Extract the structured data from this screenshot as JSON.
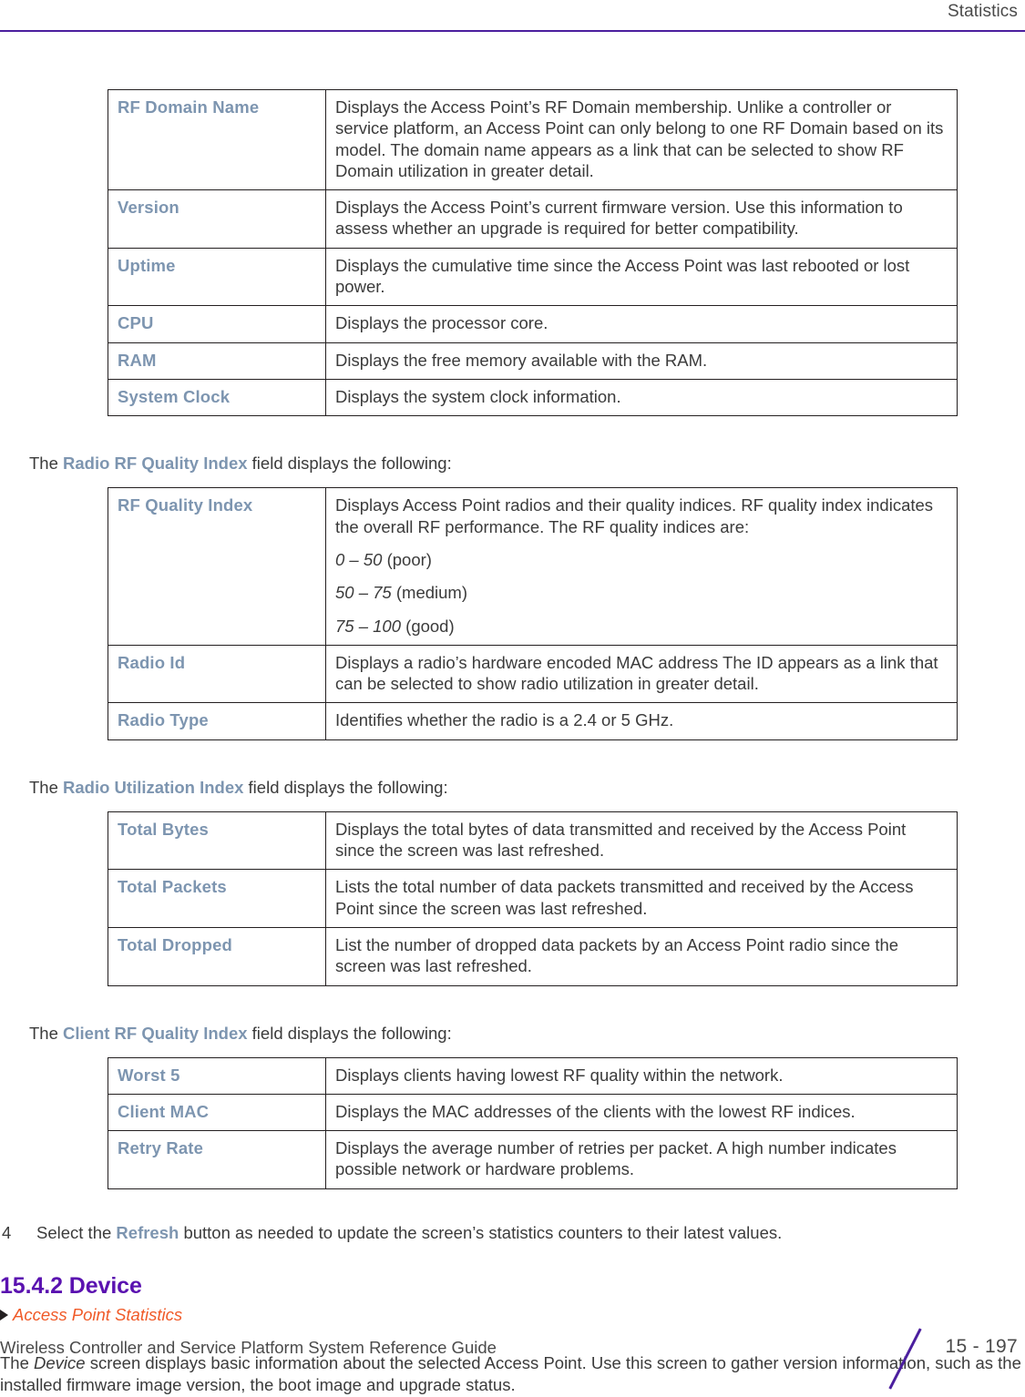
{
  "header": {
    "title": "Statistics",
    "rule_color": "#4b1f9e"
  },
  "tables": [
    {
      "name": "access-point-summary-fields",
      "rows": [
        {
          "field": "RF Domain Name",
          "description": "Displays the Access Point’s RF Domain membership. Unlike a controller or service platform, an Access Point can only belong to one RF Domain based on its model. The domain name appears as a link that can be selected to show RF Domain utilization in greater detail."
        },
        {
          "field": "Version",
          "description": "Displays the Access Point’s current firmware version. Use this information to assess whether an upgrade is required for better compatibility."
        },
        {
          "field": "Uptime",
          "description": "Displays the cumulative time since the Access Point was last rebooted or lost power."
        },
        {
          "field": "CPU",
          "description": "Displays the processor core."
        },
        {
          "field": "RAM",
          "description": "Displays the free memory available with the RAM."
        },
        {
          "field": "System Clock",
          "description": "Displays the system clock information."
        }
      ]
    },
    {
      "name": "radio-rf-quality-index-fields",
      "lead": {
        "before": "The ",
        "emphasis": "Radio RF Quality Index",
        "after": " field displays the following:"
      },
      "rows": [
        {
          "field": "RF Quality Index",
          "description": "Displays Access Point radios and their quality indices. RF quality index indicates the overall RF performance. The RF quality indices are:",
          "extra_lines": [
            {
              "range": "0 – 50",
              "label": " (poor)"
            },
            {
              "range": "50 – 75",
              "label": " (medium)"
            },
            {
              "range": "75 – 100",
              "label": " (good)"
            }
          ]
        },
        {
          "field": "Radio Id",
          "description": "Displays a radio’s hardware encoded MAC address The ID appears as a link that can be selected to show radio utilization in greater detail."
        },
        {
          "field": "Radio Type",
          "description": "Identifies whether the radio is a 2.4 or 5 GHz."
        }
      ]
    },
    {
      "name": "radio-utilization-index-fields",
      "lead": {
        "before": "The ",
        "emphasis": "Radio Utilization Index",
        "after": " field displays the following:"
      },
      "rows": [
        {
          "field": "Total Bytes",
          "description": "Displays the total bytes of data transmitted and received by the Access Point since the screen was last refreshed."
        },
        {
          "field": "Total Packets",
          "description": "Lists the total number of data packets transmitted and received by the Access Point since the screen was last refreshed."
        },
        {
          "field": "Total Dropped",
          "description": "List the number of dropped data packets by an Access Point radio since the screen was last refreshed."
        }
      ]
    },
    {
      "name": "client-rf-quality-index-fields",
      "lead": {
        "before": "The ",
        "emphasis": "Client RF Quality Index",
        "after": " field displays the following:"
      },
      "rows": [
        {
          "field": "Worst 5",
          "description": "Displays clients having lowest RF quality within the network."
        },
        {
          "field": "Client MAC",
          "description": "Displays the MAC addresses of the clients with the lowest RF indices."
        },
        {
          "field": "Retry Rate",
          "description": "Displays the average number of retries per packet. A high number indicates possible network or hardware problems."
        }
      ]
    }
  ],
  "step": {
    "number": "4",
    "before": "Select the ",
    "emphasis": "Refresh",
    "after": " button as needed to update the screen’s statistics counters to their latest values."
  },
  "section": {
    "heading": "15.4.2 Device",
    "crossref": "Access Point Statistics",
    "heading_color": "#5a12b0",
    "crossref_color": "#f05a28"
  },
  "intro": {
    "before": "The ",
    "italic": "Device",
    "after": " screen displays basic information about the selected Access Point. Use this screen to gather version information, such as the installed firmware image version, the boot image and upgrade status."
  },
  "footer": {
    "title": "Wireless Controller and Service Platform System Reference Guide",
    "page": "15 - 197",
    "slash_color": "#4b1f9e"
  }
}
